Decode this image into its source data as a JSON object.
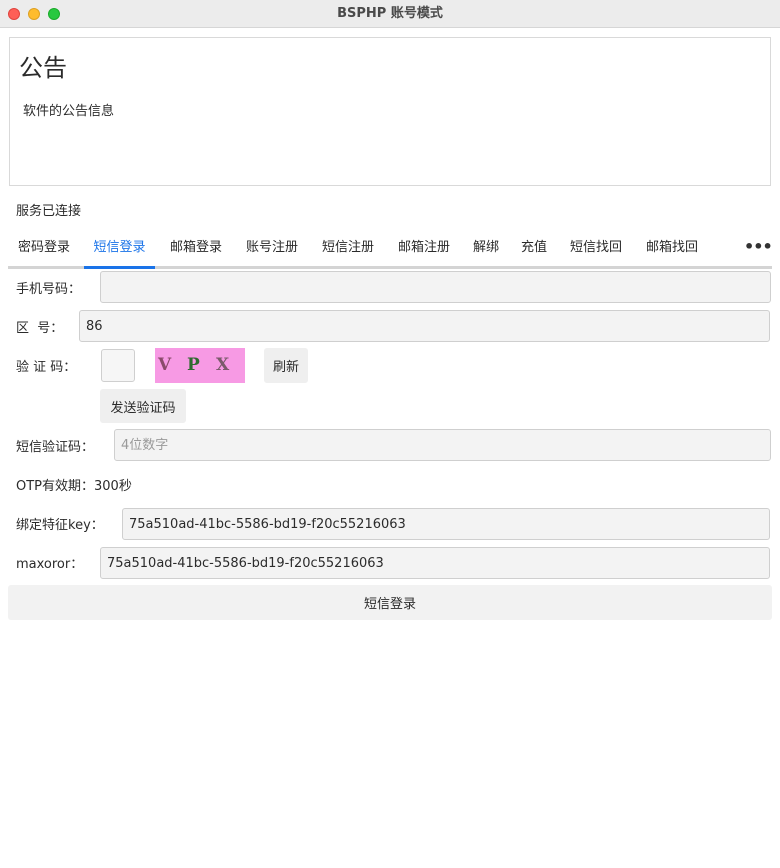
{
  "window": {
    "title": "BSPHP 账号模式"
  },
  "notice": {
    "title": "公告",
    "text": "软件的公告信息"
  },
  "status": {
    "service": "服务已连接"
  },
  "tabs": [
    {
      "label": "密码登录",
      "active": false
    },
    {
      "label": "短信登录",
      "active": true
    },
    {
      "label": "邮箱登录",
      "active": false
    },
    {
      "label": "账号注册",
      "active": false
    },
    {
      "label": "短信注册",
      "active": false
    },
    {
      "label": "邮箱注册",
      "active": false
    },
    {
      "label": "解绑",
      "active": false
    },
    {
      "label": "充值",
      "active": false
    },
    {
      "label": "短信找回",
      "active": false
    },
    {
      "label": "邮箱找回",
      "active": false
    }
  ],
  "tab_more_icon": "ellipsis-icon",
  "form": {
    "phone_label": "手机号码：",
    "phone_value": "",
    "area_label": "区  号：",
    "area_value": "86",
    "captcha_label": "验 证 码：",
    "captcha_value": "",
    "captcha_chars": [
      "V",
      "P",
      "X"
    ],
    "captcha_colors": [
      "#8a4a6a",
      "#2f6a2f",
      "#7a5a6a"
    ],
    "captcha_bg": "#f79ae4",
    "refresh_label": "刷新",
    "send_code_label": "发送验证码",
    "sms_code_label": "短信验证码：",
    "sms_code_placeholder": "4位数字",
    "otp_text": "OTP有效期：300秒",
    "key_label": "绑定特征key：",
    "key_value": "75a510ad-41bc-5586-bd19-f20c55216063",
    "maxoror_label": "maxoror：",
    "maxoror_value": "75a510ad-41bc-5586-bd19-f20c55216063",
    "submit_label": "短信登录"
  },
  "colors": {
    "accent": "#1a73e8",
    "close": "#fe5f57",
    "minimize": "#febc2e",
    "maximize": "#28c840"
  }
}
